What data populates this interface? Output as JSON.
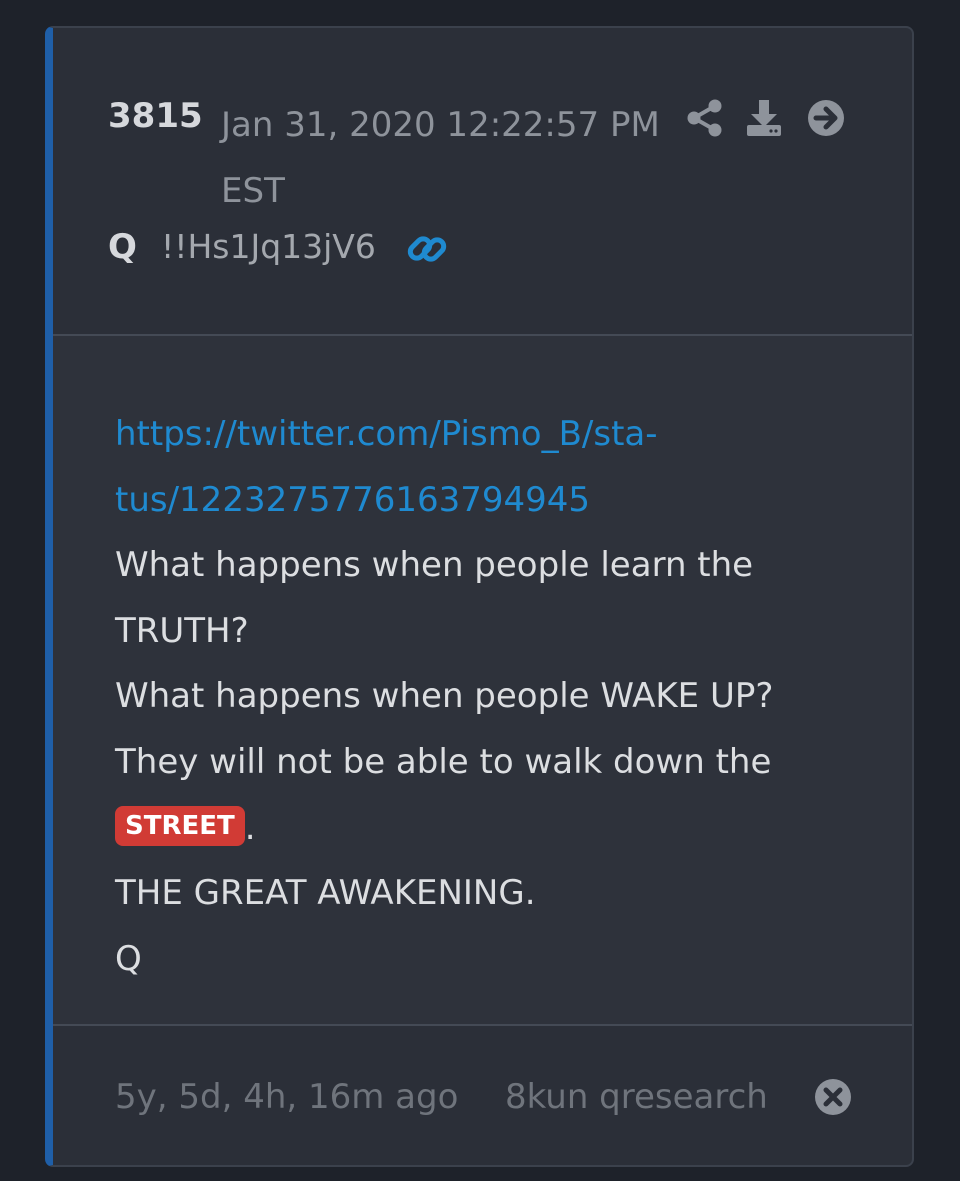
{
  "post": {
    "number": "3815",
    "timestamp": "Jan 31, 2020 12:22:57 PM EST",
    "author": "Q",
    "tripcode": "!!Hs1Jq13jV6"
  },
  "header_icons": {
    "share": "share-icon",
    "download": "download-icon",
    "goto": "arrow-circle-right-icon",
    "permalink": "link-icon"
  },
  "body": {
    "link_line_1": "https://twitter.com/Pismo_B/sta-",
    "link_line_2": "tus/1223275776163794945",
    "line_1": "What happens when people learn the",
    "line_2": "TRUTH?",
    "line_3": "What happens when people WAKE UP?",
    "line_4": "They will not be able to walk down the",
    "badge": "STREET",
    "badge_suffix": ".",
    "line_6": "THE GREAT AWAKENING.",
    "signature": "Q"
  },
  "footer": {
    "relative_time": "5y, 5d, 4h, 16m ago",
    "source": "8kun qresearch",
    "close_icon": "close-circle-icon"
  },
  "colors": {
    "background": "#1e222a",
    "card": "#2b2f38",
    "accent_border": "#1f5fa8",
    "link": "#1f8ad0",
    "badge": "#d13b35"
  }
}
